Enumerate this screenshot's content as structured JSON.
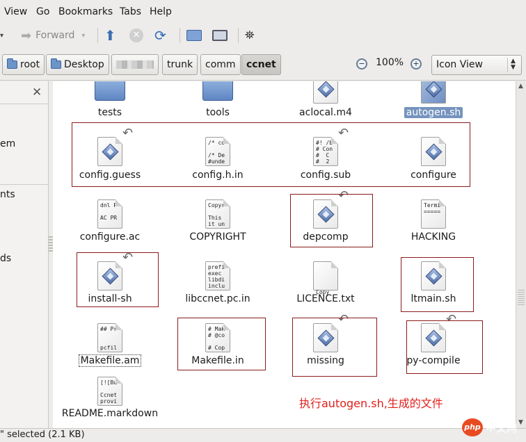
{
  "menu": {
    "view": "View",
    "go": "Go",
    "bookmarks": "Bookmarks",
    "tabs": "Tabs",
    "help": "Help"
  },
  "toolbar": {
    "forward_label": "Forward"
  },
  "location": {
    "crumbs": [
      "root",
      "Desktop",
      "trunk",
      "comm",
      "ccnet"
    ],
    "zoom_level": "100%",
    "view_mode": "Icon View"
  },
  "sidebar": {
    "fragments": [
      "em",
      "nts",
      "ds"
    ]
  },
  "files": [
    {
      "name": "tests",
      "kind": "folder"
    },
    {
      "name": "tools",
      "kind": "folder"
    },
    {
      "name": "aclocal.m4",
      "kind": "script"
    },
    {
      "name": "autogen.sh",
      "kind": "script",
      "selected": true
    },
    {
      "name": "config.guess",
      "kind": "script",
      "symlink": true
    },
    {
      "name": "config.h.in",
      "kind": "text",
      "preview": "/* co\n\n/* De\n#unde"
    },
    {
      "name": "config.sub",
      "kind": "text",
      "preview": "#! /b\n# Con\n#  C\n#  2",
      "symlink": true
    },
    {
      "name": "configure",
      "kind": "script"
    },
    {
      "name": "configure.ac",
      "kind": "text",
      "preview": "dnl P\n\nAC PR"
    },
    {
      "name": "COPYRIGHT",
      "kind": "text",
      "preview": "Copyr\n\nThis\nit un"
    },
    {
      "name": "depcomp",
      "kind": "script",
      "symlink": true
    },
    {
      "name": "HACKING",
      "kind": "text",
      "preview": "Termi\n====="
    },
    {
      "name": "install-sh",
      "kind": "script",
      "symlink": true
    },
    {
      "name": "libccnet.pc.in",
      "kind": "text",
      "preview": "prefi\nexec\nlibdi\ninclu"
    },
    {
      "name": "LICENCE.txt",
      "kind": "text",
      "preview": "\n\n\n\nCopy"
    },
    {
      "name": "ltmain.sh",
      "kind": "script"
    },
    {
      "name": "Makefile.am",
      "kind": "text",
      "preview": "## Pr\n\n\npcfil",
      "focused": true
    },
    {
      "name": "Makefile.in",
      "kind": "text",
      "preview": "# Mak\n# @co\n\n# Cop"
    },
    {
      "name": "missing",
      "kind": "script",
      "symlink": true
    },
    {
      "name": "py-compile",
      "kind": "script",
      "symlink": true
    },
    {
      "name": "README.markdown",
      "kind": "text",
      "preview": "[![Bu\n\nCcnet\nprovi"
    }
  ],
  "annotation": "执行autogen.sh,生成的文件",
  "status": "\" selected (2.1 KB)",
  "watermark": "中文网",
  "watermark_logo": "php"
}
